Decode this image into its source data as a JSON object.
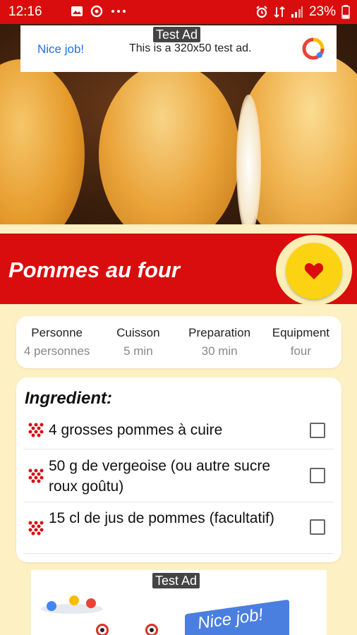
{
  "status_bar": {
    "time": "12:16",
    "battery": "23%",
    "icons": [
      "image-icon",
      "sync-icon",
      "more-dots-icon",
      "alarm-icon",
      "data-icon",
      "signal-icon",
      "battery-icon"
    ]
  },
  "top_ad": {
    "tag": "Test Ad",
    "cta": "Nice job!",
    "text": "This is a 320x50 test ad."
  },
  "recipe": {
    "title": "Pommes au four",
    "favorite_icon": "heart-icon"
  },
  "info": [
    {
      "label": "Personne",
      "value": "4 personnes"
    },
    {
      "label": "Cuisson",
      "value": "5 min"
    },
    {
      "label": "Preparation",
      "value": "30 min"
    },
    {
      "label": "Equipment",
      "value": "four"
    }
  ],
  "ingredients": {
    "heading": "Ingredient:",
    "items": [
      {
        "text": "4 grosses pommes à cuire",
        "checked": false
      },
      {
        "text": "50 g de vergeoise (ou autre sucre roux goûtu)",
        "checked": false
      },
      {
        "text": "15 cl de jus de pommes (facultatif)",
        "checked": false
      }
    ]
  },
  "bottom_ad": {
    "tag": "Test Ad",
    "headline": "Nice job!"
  },
  "colors": {
    "primary_red": "#d90d0d",
    "background": "#fdf0c2",
    "fav_yellow": "#fcd313",
    "ad_blue": "#1a73e8"
  }
}
